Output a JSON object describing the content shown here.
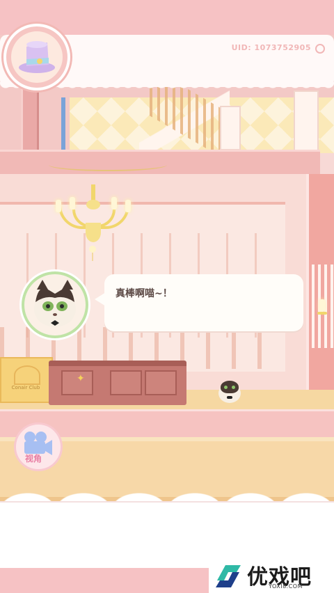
{
  "header": {
    "uid_text": "UID: 1073752905"
  },
  "dialog": {
    "text": "真棒啊喵~！"
  },
  "controls": {
    "camera_label": "视角"
  },
  "decor": {
    "counter_sign": "Conair Club"
  },
  "watermark": {
    "brand_text": "优戏吧",
    "brand_url": "YOXI8.COM"
  },
  "colors": {
    "accent_pink": "#f6c2c4",
    "uid_text": "#f1b7b7",
    "camera_icon": "#a7bff2"
  }
}
